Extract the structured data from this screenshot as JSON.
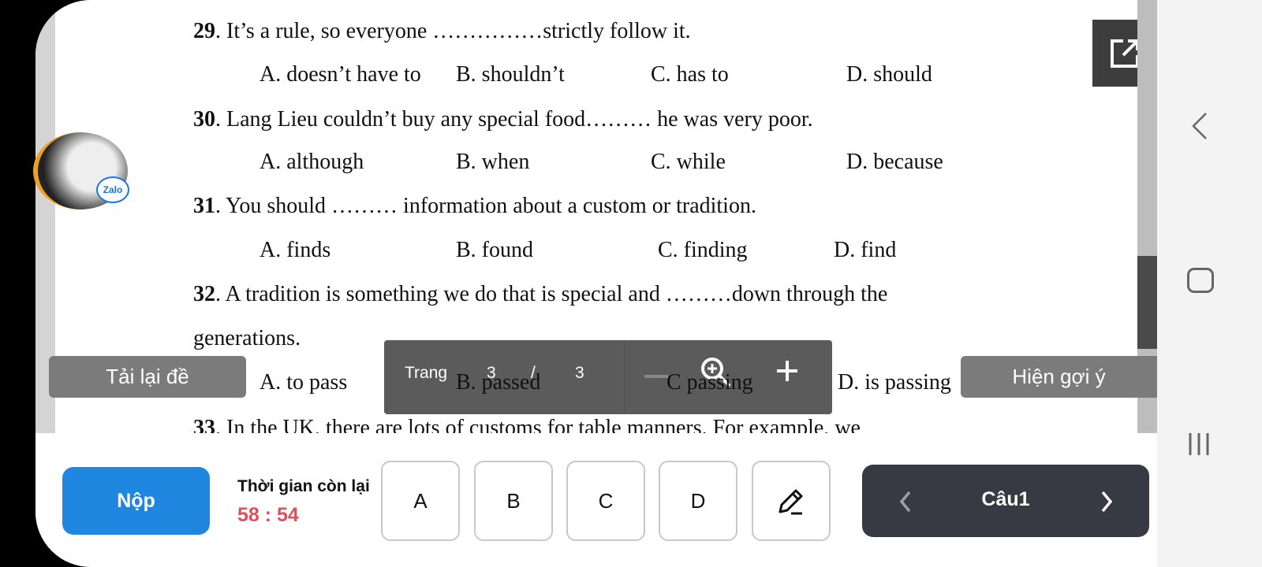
{
  "questions": [
    {
      "num": "29",
      "text": ". It’s a rule, so everyone ……………strictly follow it.",
      "options": [
        "A. doesn’t have to",
        "B. shouldn’t",
        "C. has to",
        "D. should"
      ]
    },
    {
      "num": "30",
      "text": ". Lang Lieu couldn’t buy any special food……… he was very poor.",
      "options": [
        "A. although",
        "B. when",
        "C. while",
        "D. because"
      ]
    },
    {
      "num": "31",
      "text": ". You should ……… information about a custom or tradition.",
      "options": [
        "A. finds",
        "B. found",
        "C. finding",
        "D. find"
      ]
    },
    {
      "num": "32",
      "text": ". A tradition is something we do that is special and ………down through the",
      "text2": "generations.",
      "options": [
        "A. to pass",
        "B. passed",
        "C passing",
        "D. is passing"
      ]
    },
    {
      "num": "33",
      "text": ". In the UK, there are lots of customs for table manners. For example, we"
    }
  ],
  "floating_chat": {
    "label": "Zalo",
    "accent": "#1a73e8"
  },
  "toolbar": {
    "reload": "Tải lại đề",
    "hint": "Hiện gợi ý"
  },
  "pager": {
    "page_label": "Trang",
    "current": "3",
    "separator": "/",
    "total": "3"
  },
  "bottom": {
    "submit": "Nộp",
    "time_label": "Thời gian còn lại",
    "time_value": "58 : 54",
    "answers": [
      "A",
      "B",
      "C",
      "D"
    ],
    "question_label": "Câu1"
  },
  "colors": {
    "submit": "#1f87e0",
    "timer": "#e0505a",
    "nav": "#373a42"
  }
}
